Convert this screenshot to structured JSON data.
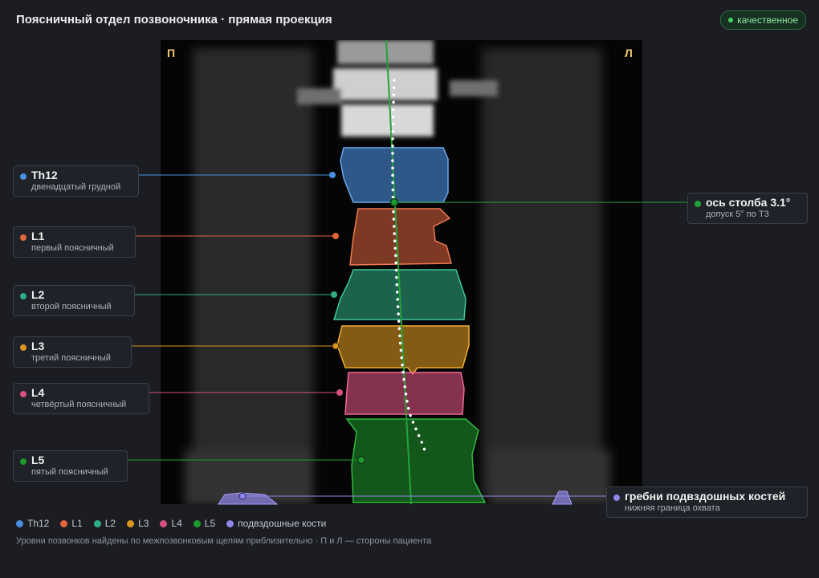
{
  "title": "Поясничный отдел позвоночника · прямая проекция",
  "badge": "качественное",
  "side_labels": {
    "right_patient": "П",
    "left_patient": "Л"
  },
  "vertebrae": [
    {
      "id": "th12",
      "name": "Th12",
      "sub": "двенадцатый грудной",
      "color": "#4a8fe0"
    },
    {
      "id": "l1",
      "name": "L1",
      "sub": "первый поясничный",
      "color": "#e0643c"
    },
    {
      "id": "l2",
      "name": "L2",
      "sub": "второй поясничный",
      "color": "#2fae86"
    },
    {
      "id": "l3",
      "name": "L3",
      "sub": "третий поясничный",
      "color": "#d9951f"
    },
    {
      "id": "l4",
      "name": "L4",
      "sub": "четвёртый поясничный",
      "color": "#d9507f"
    },
    {
      "id": "l5",
      "name": "L5",
      "sub": "пятый поясничный",
      "color": "#1f9a2e"
    }
  ],
  "axis": {
    "name": "ось столба 3.1°",
    "sub": "допуск 5° по Т3",
    "color": "#23a33a"
  },
  "iliac": {
    "name": "гребни подвздошных костей",
    "sub": "нижняя граница охвата",
    "color": "#8f86e8"
  },
  "legend": [
    {
      "label": "Th12",
      "color": "#4a8fe0"
    },
    {
      "label": "L1",
      "color": "#e0643c"
    },
    {
      "label": "L2",
      "color": "#2fae86"
    },
    {
      "label": "L3",
      "color": "#d9951f"
    },
    {
      "label": "L4",
      "color": "#d9507f"
    },
    {
      "label": "L5",
      "color": "#1f9a2e"
    },
    {
      "label": "подвздошные кости",
      "color": "#8f86e8"
    }
  ],
  "footnote": "Уровни позвонков найдены по межпозвонковым щелям приблизительно · П и Л — стороны пациента"
}
